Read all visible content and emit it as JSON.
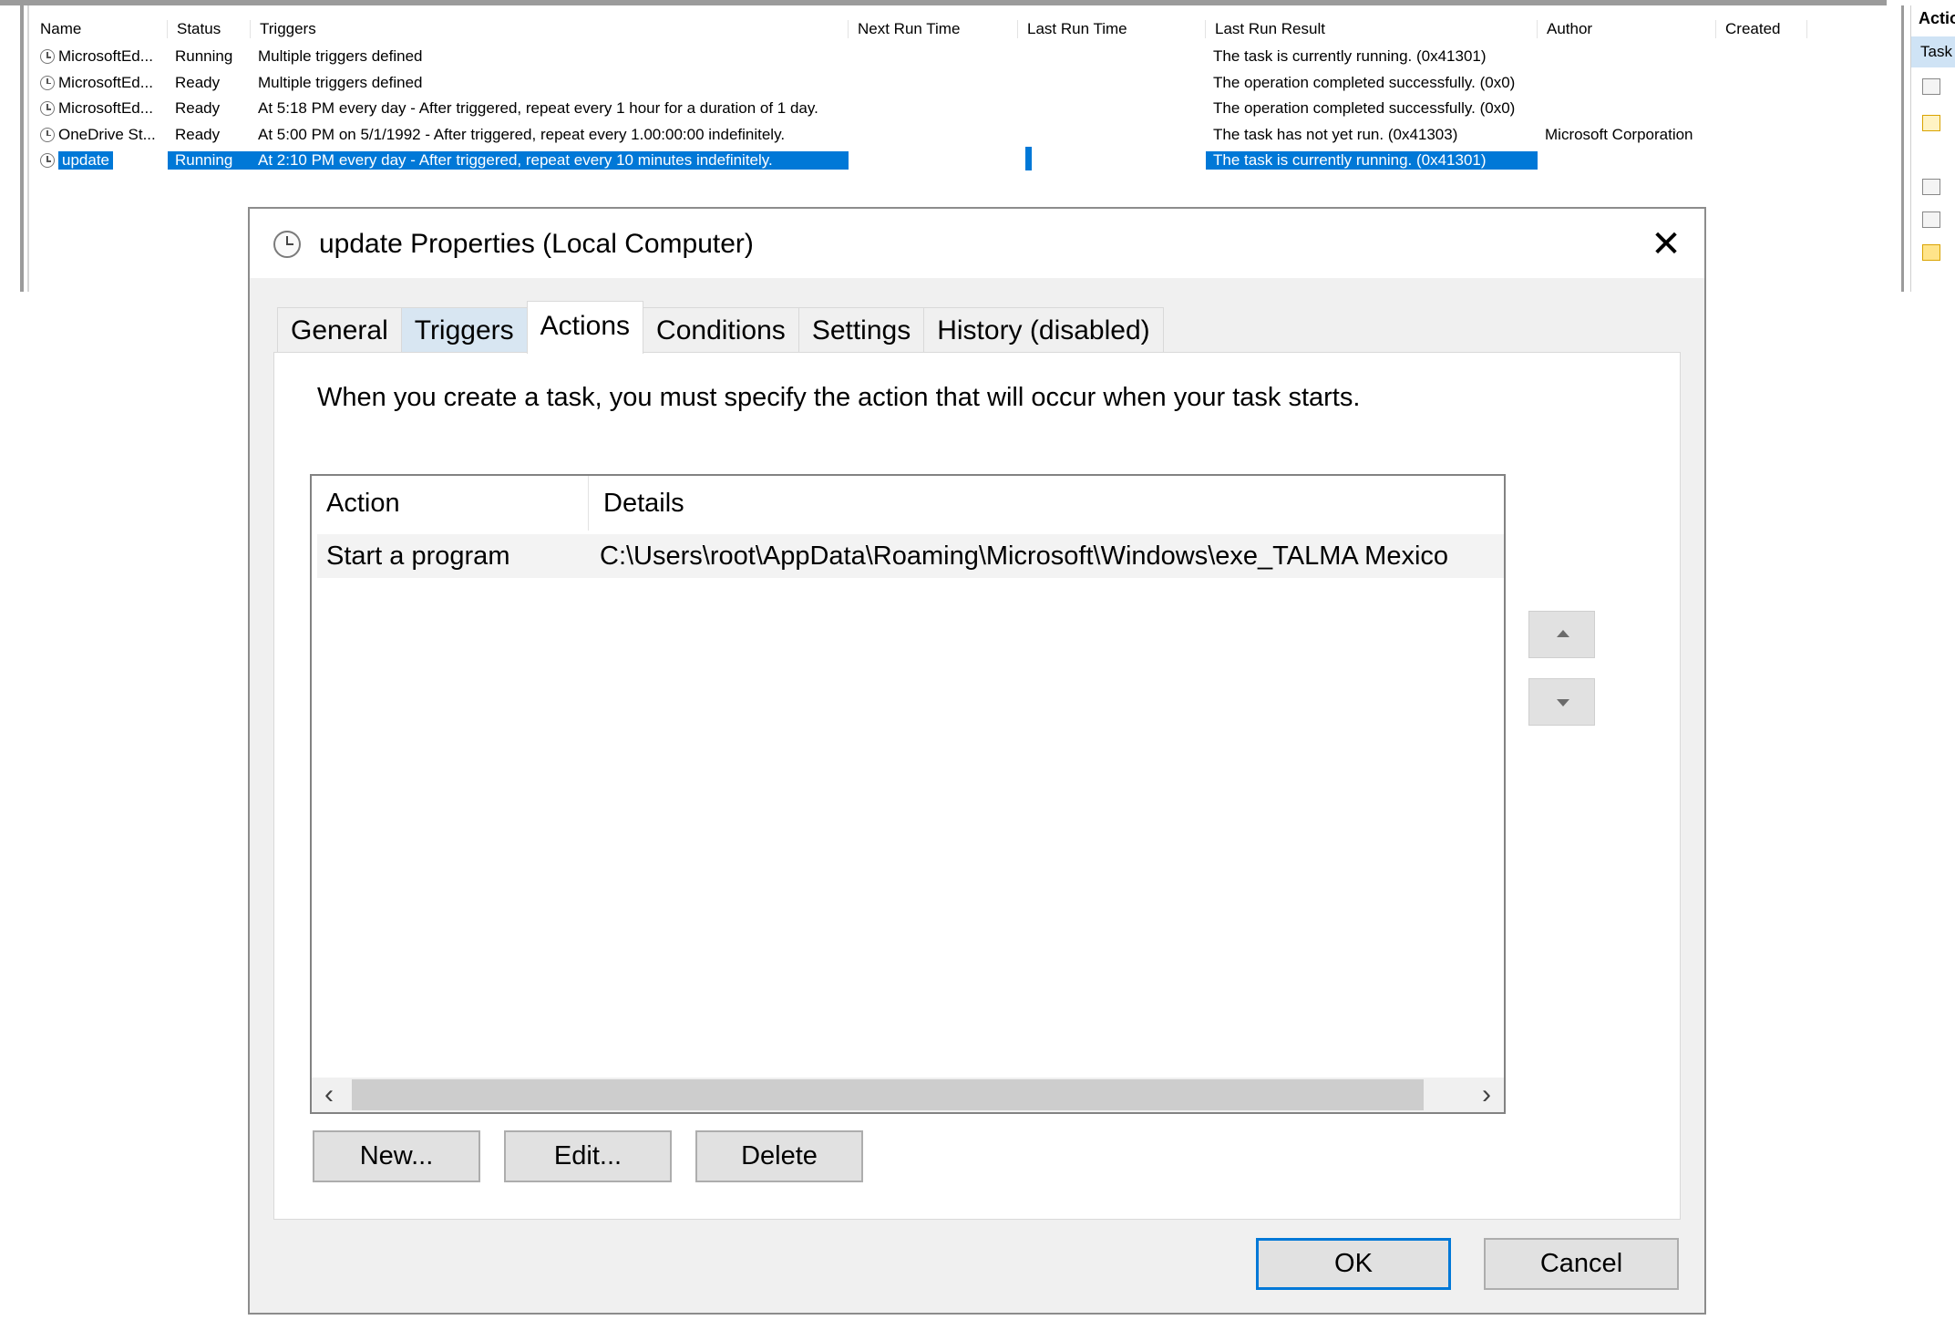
{
  "task_list": {
    "columns": [
      "Name",
      "Status",
      "Triggers",
      "Next Run Time",
      "Last Run Time",
      "Last Run Result",
      "Author",
      "Created"
    ],
    "rows": [
      {
        "name": "MicrosoftEd...",
        "status": "Running",
        "triggers": "Multiple triggers defined",
        "next_run": "",
        "last_run": "",
        "result": "The task is currently running. (0x41301)",
        "author": "",
        "created": ""
      },
      {
        "name": "MicrosoftEd...",
        "status": "Ready",
        "triggers": "Multiple triggers defined",
        "next_run": "",
        "last_run": "",
        "result": "The operation completed successfully. (0x0)",
        "author": "",
        "created": ""
      },
      {
        "name": "MicrosoftEd...",
        "status": "Ready",
        "triggers": "At 5:18 PM every day - After triggered, repeat every 1 hour for a duration of 1 day.",
        "next_run": "",
        "last_run": "",
        "result": "The operation completed successfully. (0x0)",
        "author": "",
        "created": ""
      },
      {
        "name": "OneDrive St...",
        "status": "Ready",
        "triggers": "At 5:00 PM on 5/1/1992 - After triggered, repeat every 1.00:00:00 indefinitely.",
        "next_run": "",
        "last_run": "",
        "result": "The task has not yet run. (0x41303)",
        "author": "Microsoft Corporation",
        "created": ""
      },
      {
        "name": "update",
        "status": "Running",
        "triggers": "At 2:10 PM every day - After triggered, repeat every 10 minutes indefinitely.",
        "next_run": "",
        "last_run": "",
        "result": "The task is currently running. (0x41301)",
        "author": "",
        "created": "",
        "selected": true
      }
    ]
  },
  "actions_pane": {
    "title": "Actio",
    "subtitle": "Task"
  },
  "dialog": {
    "title": "update Properties (Local Computer)",
    "close_glyph": "✕",
    "tabs": [
      {
        "label": "General"
      },
      {
        "label": "Triggers"
      },
      {
        "label": "Actions"
      },
      {
        "label": "Conditions"
      },
      {
        "label": "Settings"
      },
      {
        "label": "History (disabled)"
      }
    ],
    "active_tab": "Actions",
    "intro": "When you create a task, you must specify the action that will occur when your task starts.",
    "action_list": {
      "columns": [
        "Action",
        "Details"
      ],
      "rows": [
        {
          "action": "Start a program",
          "details": "C:\\Users\\root\\AppData\\Roaming\\Microsoft\\Windows\\exe_TALMA Mexico"
        }
      ]
    },
    "scroll_left": "‹",
    "scroll_right": "›",
    "buttons": {
      "new": "New...",
      "edit": "Edit...",
      "delete": "Delete",
      "ok": "OK",
      "cancel": "Cancel"
    }
  },
  "colors": {
    "selection": "#0078d7",
    "dialog_bg": "#f0f0f0",
    "button_bg": "#e1e1e1"
  }
}
